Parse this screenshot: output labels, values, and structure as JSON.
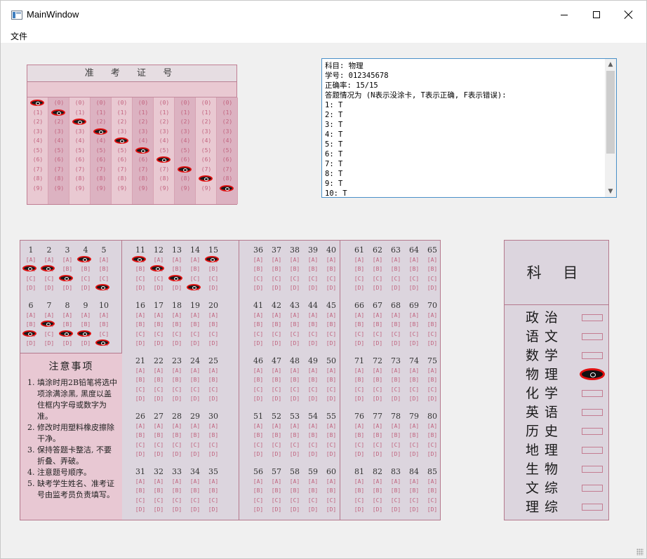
{
  "window": {
    "title": "MainWindow",
    "controls": {
      "minimize": "—",
      "maximize": "☐",
      "close": "✕"
    }
  },
  "menubar": {
    "items": [
      {
        "label": "文件"
      }
    ]
  },
  "exam_card": {
    "header": "准 考 证 号",
    "digits": [
      "0",
      "1",
      "2",
      "3",
      "4",
      "5",
      "6",
      "7",
      "8",
      "9"
    ],
    "marked_digits": [
      0,
      1,
      2,
      3,
      4,
      5,
      6,
      7,
      8,
      9
    ]
  },
  "result": {
    "lines": [
      "科目: 物理",
      "学号: 012345678",
      "正确率: 15/15",
      "答题情况为 (N表示没涂卡, T表示正确, F表示错误):",
      "1: T",
      "2: T",
      "3: T",
      "4: T",
      "5: T",
      "6: T",
      "7: T",
      "8: T",
      "9: T",
      "10: T"
    ]
  },
  "answer_card": {
    "options": [
      "A",
      "B",
      "C",
      "D"
    ],
    "blocks": [
      {
        "groups": [
          {
            "numbers": [
              1,
              2,
              3,
              4,
              5
            ],
            "marks": [
              "B",
              "B",
              "C",
              "A",
              "D"
            ]
          },
          {
            "numbers": [
              6,
              7,
              8,
              9,
              10
            ],
            "marks": [
              "C",
              "B",
              "C",
              "C",
              "D"
            ]
          }
        ]
      },
      {
        "groups": [
          {
            "numbers": [
              11,
              12,
              13,
              14,
              15
            ],
            "marks": [
              "A",
              "B",
              "C",
              "D",
              "A"
            ]
          },
          {
            "numbers": [
              16,
              17,
              18,
              19,
              20
            ],
            "marks": []
          },
          {
            "numbers": [
              21,
              22,
              23,
              24,
              25
            ],
            "marks": []
          },
          {
            "numbers": [
              26,
              27,
              28,
              29,
              30
            ],
            "marks": []
          },
          {
            "numbers": [
              31,
              32,
              33,
              34,
              35
            ],
            "marks": []
          }
        ]
      },
      {
        "groups": [
          {
            "numbers": [
              36,
              37,
              38,
              39,
              40
            ],
            "marks": []
          },
          {
            "numbers": [
              41,
              42,
              43,
              44,
              45
            ],
            "marks": []
          },
          {
            "numbers": [
              46,
              47,
              48,
              49,
              50
            ],
            "marks": []
          },
          {
            "numbers": [
              51,
              52,
              53,
              54,
              55
            ],
            "marks": []
          },
          {
            "numbers": [
              56,
              57,
              58,
              59,
              60
            ],
            "marks": []
          }
        ]
      },
      {
        "groups": [
          {
            "numbers": [
              61,
              62,
              63,
              64,
              65
            ],
            "marks": []
          },
          {
            "numbers": [
              66,
              67,
              68,
              69,
              70
            ],
            "marks": []
          },
          {
            "numbers": [
              71,
              72,
              73,
              74,
              75
            ],
            "marks": []
          },
          {
            "numbers": [
              76,
              77,
              78,
              79,
              80
            ],
            "marks": []
          },
          {
            "numbers": [
              81,
              82,
              83,
              84,
              85
            ],
            "marks": []
          }
        ]
      }
    ],
    "notes": {
      "title": "注意事项",
      "items": [
        "1. 填涂时用2B铅笔将选中项涂满涂黑, 黑度以盖住框内字母或数字为准。",
        "2. 修改时用塑料橡皮擦除干净。",
        "3. 保持答题卡整洁, 不要折叠、弄破。",
        "4. 注意题号顺序。",
        "5. 缺考学生姓名、准考证号由监考员负责填写。"
      ]
    }
  },
  "subject_card": {
    "header": "科 目",
    "subjects": [
      "政治",
      "语文",
      "数学",
      "物理",
      "化学",
      "英语",
      "历史",
      "地理",
      "生物",
      "文综",
      "理综"
    ],
    "selected": "物理"
  },
  "colors": {
    "accent": "#4a90c8",
    "mark_outline": "#e01010",
    "card_pink": "#e9c9d2"
  }
}
